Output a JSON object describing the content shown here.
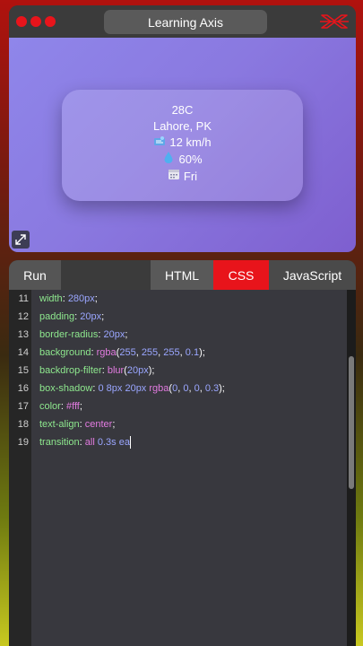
{
  "window": {
    "title": "Learning Axis",
    "colors": {
      "accent": "#e8141b"
    }
  },
  "preview": {
    "temperature": "28C",
    "location": "Lahore, PK",
    "wind": "12 km/h",
    "humidity": "60%",
    "day": "Fri",
    "icons": [
      "wind-icon",
      "droplet-icon",
      "calendar-icon"
    ]
  },
  "toolbar": {
    "run_label": "Run",
    "tabs": [
      "HTML",
      "CSS",
      "JavaScript"
    ],
    "active_tab": "CSS"
  },
  "editor": {
    "lines": [
      {
        "n": "11",
        "prop": "width",
        "parts": [
          {
            "t": "280px",
            "c": "num"
          }
        ]
      },
      {
        "n": "12",
        "prop": "padding",
        "parts": [
          {
            "t": "20px",
            "c": "num"
          }
        ]
      },
      {
        "n": "13",
        "prop": "border-radius",
        "parts": [
          {
            "t": "20px",
            "c": "num"
          }
        ]
      },
      {
        "n": "14",
        "prop": "background",
        "parts": [
          {
            "t": "rgba",
            "c": "fn"
          },
          {
            "t": "(",
            "c": "punc"
          },
          {
            "t": "255",
            "c": "num"
          },
          {
            "t": ", ",
            "c": "punc"
          },
          {
            "t": "255",
            "c": "num"
          },
          {
            "t": ", ",
            "c": "punc"
          },
          {
            "t": "255",
            "c": "num"
          },
          {
            "t": ", ",
            "c": "punc"
          },
          {
            "t": "0.1",
            "c": "num"
          },
          {
            "t": ")",
            "c": "punc"
          }
        ]
      },
      {
        "n": "15",
        "prop": "backdrop-filter",
        "parts": [
          {
            "t": "blur",
            "c": "fn"
          },
          {
            "t": "(",
            "c": "punc"
          },
          {
            "t": "20px",
            "c": "num"
          },
          {
            "t": ")",
            "c": "punc"
          }
        ]
      },
      {
        "n": "16",
        "prop": "box-shadow",
        "parts": [
          {
            "t": "0",
            "c": "num"
          },
          {
            "t": " ",
            "c": "punc"
          },
          {
            "t": "8px",
            "c": "num"
          },
          {
            "t": " ",
            "c": "punc"
          },
          {
            "t": "20px",
            "c": "num"
          },
          {
            "t": " ",
            "c": "punc"
          },
          {
            "t": "rgba",
            "c": "fn"
          },
          {
            "t": "(",
            "c": "punc"
          },
          {
            "t": "0",
            "c": "num"
          },
          {
            "t": ", ",
            "c": "punc"
          },
          {
            "t": "0",
            "c": "num"
          },
          {
            "t": ", ",
            "c": "punc"
          },
          {
            "t": "0",
            "c": "num"
          },
          {
            "t": ", ",
            "c": "punc"
          },
          {
            "t": "0.3",
            "c": "num"
          },
          {
            "t": ")",
            "c": "punc"
          }
        ]
      },
      {
        "n": "17",
        "prop": "color",
        "parts": [
          {
            "t": "#fff",
            "c": "fn"
          }
        ]
      },
      {
        "n": "18",
        "prop": "text-align",
        "parts": [
          {
            "t": "center",
            "c": "kw"
          }
        ]
      },
      {
        "n": "19",
        "prop": "transition",
        "parts": [
          {
            "t": "all",
            "c": "kw"
          },
          {
            "t": " ",
            "c": "punc"
          },
          {
            "t": "0.3s",
            "c": "num"
          },
          {
            "t": " ",
            "c": "punc"
          },
          {
            "t": "ea",
            "c": "num"
          }
        ],
        "open": true
      }
    ]
  }
}
